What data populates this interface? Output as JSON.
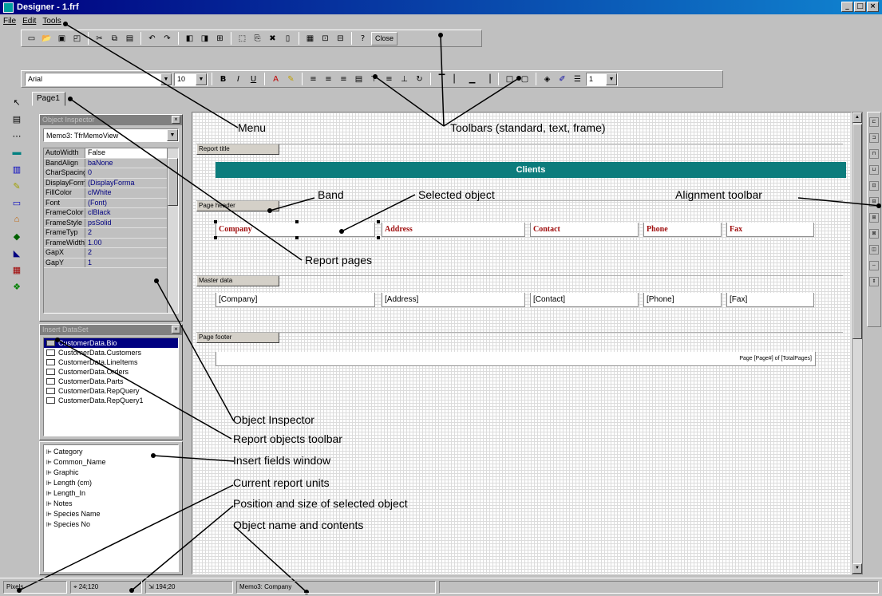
{
  "window": {
    "title": "Designer - 1.frf",
    "buttons": [
      "_",
      "□",
      "×"
    ]
  },
  "menu": [
    "File",
    "Edit",
    "Tools"
  ],
  "toolbar": {
    "close_label": "Close",
    "font_name": "Arial",
    "font_size": "10",
    "line_width": "1"
  },
  "page_tab": "Page1",
  "object_inspector": {
    "title": "Object Inspector",
    "selected": "Memo3: TfrMemoView",
    "props": [
      {
        "k": "AutoWidth",
        "v": "False"
      },
      {
        "k": "BandAlign",
        "v": "baNone"
      },
      {
        "k": "CharSpacing",
        "v": "0"
      },
      {
        "k": "DisplayFormat",
        "v": "(DisplayForma"
      },
      {
        "k": "FillColor",
        "v": "clWhite"
      },
      {
        "k": "Font",
        "v": "(Font)"
      },
      {
        "k": "FrameColor",
        "v": "clBlack"
      },
      {
        "k": "FrameStyle",
        "v": "psSolid"
      },
      {
        "k": "FrameTyp",
        "v": "2"
      },
      {
        "k": "FrameWidth",
        "v": "1.00"
      },
      {
        "k": "GapX",
        "v": "2"
      },
      {
        "k": "GapY",
        "v": "1"
      }
    ]
  },
  "insert_dataset": {
    "title": "Insert DataSet",
    "items": [
      "CustomerData.Bio",
      "CustomerData.Customers",
      "CustomerData.LineItems",
      "CustomerData.Orders",
      "CustomerData.Parts",
      "CustomerData.RepQuery",
      "CustomerData.RepQuery1"
    ]
  },
  "fields": [
    "Category",
    "Common_Name",
    "Graphic",
    "Length (cm)",
    "Length_In",
    "Notes",
    "Species Name",
    "Species No"
  ],
  "report": {
    "bands": [
      "Report title",
      "Page header",
      "Master data",
      "Page footer"
    ],
    "title_text": "Clients",
    "header_cells": [
      "Company",
      "Address",
      "Contact",
      "Phone",
      "Fax"
    ],
    "data_cells": [
      "[Company]",
      "[Address]",
      "[Contact]",
      "[Phone]",
      "[Fax]"
    ],
    "footer_text": "Page [Page#] of [TotalPages]"
  },
  "callouts": {
    "menu": "Menu",
    "toolbars": "Toolbars (standard, text, frame)",
    "band": "Band",
    "selected_object": "Selected object",
    "alignment_toolbar": "Alignment toolbar",
    "report_pages": "Report pages",
    "object_inspector": "Object Inspector",
    "report_objects_toolbar": "Report objects toolbar",
    "insert_fields": "Insert fields window",
    "report_units": "Current report units",
    "position_size": "Position and size of selected object",
    "object_name": "Object name and contents"
  },
  "status": {
    "units": "Pixels",
    "position": "24;120",
    "size": "194;20",
    "object": "Memo3: Company"
  }
}
